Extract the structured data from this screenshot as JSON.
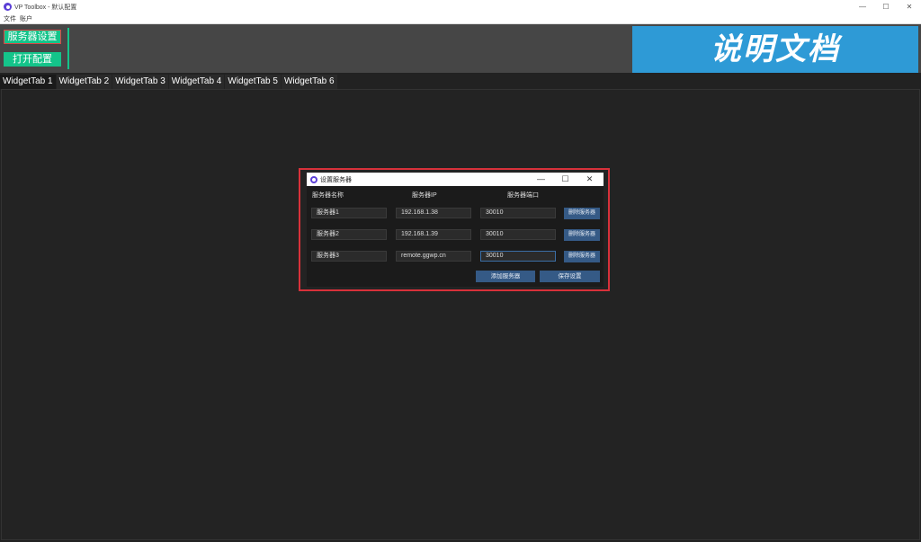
{
  "window": {
    "title": "VP Toolbox - 默认配置",
    "controls": [
      "—",
      "☐",
      "✕"
    ]
  },
  "menu": [
    "文件",
    "账户"
  ],
  "toolbar": {
    "server_settings_label": "服务器设置",
    "open_config_label": "打开配置",
    "doc_banner": "说明文档"
  },
  "tabs": [
    "WidgetTab 1",
    "WidgetTab 2",
    "WidgetTab 3",
    "WidgetTab 4",
    "WidgetTab 5",
    "WidgetTab 6"
  ],
  "dialog": {
    "title": "设置服务器",
    "controls": [
      "—",
      "☐",
      "✕"
    ],
    "headers": {
      "name": "服务器名称",
      "ip": "服务器IP",
      "port": "服务器端口"
    },
    "rows": [
      {
        "name": "服务器1",
        "ip": "192.168.1.38",
        "port": "30010",
        "delete_label": "删除服务器"
      },
      {
        "name": "服务器2",
        "ip": "192.168.1.39",
        "port": "30010",
        "delete_label": "删除服务器"
      },
      {
        "name": "服务器3",
        "ip": "remote.ggwp.cn",
        "port": "30010",
        "delete_label": "删除服务器"
      }
    ],
    "add_label": "添加服务器",
    "save_label": "保存设置"
  },
  "colors": {
    "accent_green": "#14c48a",
    "banner_blue": "#2e9ad6",
    "button_blue": "#355a86",
    "highlight_red": "#d8313a",
    "background": "#222222"
  }
}
